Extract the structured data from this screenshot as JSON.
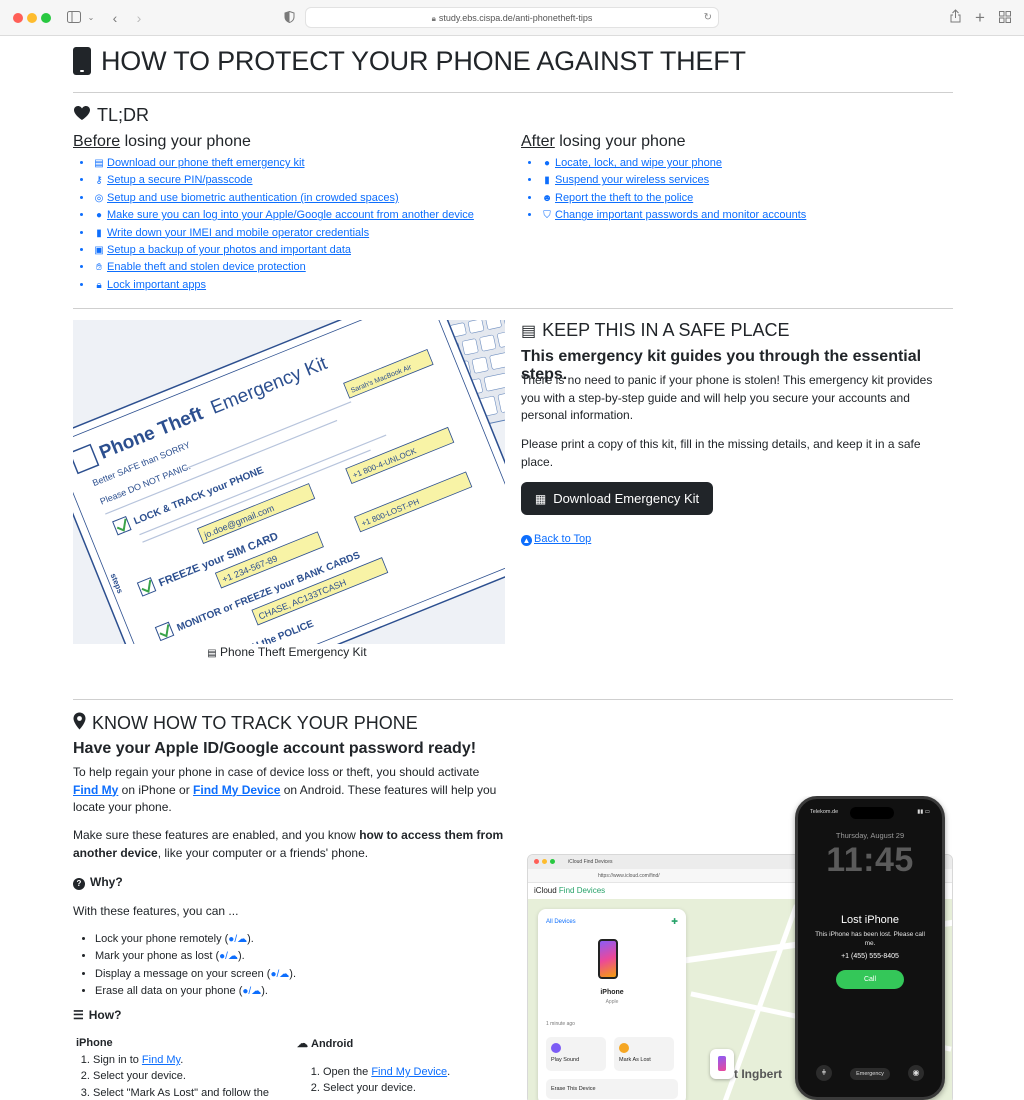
{
  "browser": {
    "url": "study.ebs.cispa.de/anti-phonetheft-tips"
  },
  "header": {
    "title": "HOW TO PROTECT YOUR PHONE AGAINST THEFT"
  },
  "tldr": {
    "heading": "TL;DR",
    "before": {
      "heading_u": "Before",
      "heading_rest": " losing your phone",
      "items": [
        {
          "icon": "pdf-icon",
          "label": "Download our phone theft emergency kit"
        },
        {
          "icon": "key-icon",
          "label": "Setup a secure PIN/passcode"
        },
        {
          "icon": "fingerprint-icon",
          "label": "Setup and use biometric authentication (in crowded spaces)"
        },
        {
          "icon": "location-pin-icon",
          "label": "Make sure you can log into your Apple/Google account from another device"
        },
        {
          "icon": "phone-icon",
          "label": "Write down your IMEI and mobile operator credentials"
        },
        {
          "icon": "images-icon",
          "label": "Setup a backup of your photos and important data"
        },
        {
          "icon": "hand-icon",
          "label": "Enable theft and stolen device protection"
        },
        {
          "icon": "lock-icon",
          "label": "Lock important apps"
        }
      ]
    },
    "after": {
      "heading_u": "After",
      "heading_rest": " losing your phone",
      "items": [
        {
          "icon": "location-pin-icon",
          "label": "Locate, lock, and wipe your phone"
        },
        {
          "icon": "phone-icon",
          "label": "Suspend your wireless services"
        },
        {
          "icon": "police-icon",
          "label": "Report the theft to the police"
        },
        {
          "icon": "shield-icon",
          "label": "Change important passwords and monitor accounts"
        }
      ]
    }
  },
  "kit": {
    "heading": "KEEP THIS IN A SAFE PLACE",
    "subheading": "This emergency kit guides you through the essential steps.",
    "para1": "There is no need to panic if your phone is stolen! This emergency kit provides you with a step-by-step guide and will help you secure your accounts and personal information.",
    "para2": "Please print a copy of this kit, fill in the missing details, and keep it in a safe place.",
    "button": "Download Emergency Kit",
    "back_to_top": "Back to Top",
    "caption": "Phone Theft Emergency Kit",
    "image": {
      "title_a": "Phone Theft",
      "title_b": "Emergency Kit",
      "tagline": "Better SAFE than SORRY",
      "dont_panic": "Please DO NOT PANIC.",
      "lock_track": "LOCK & TRACK your PHONE",
      "freeze_sim": "FREEZE your SIM CARD",
      "monitor": "MONITOR or FREEZE your BANK CARDS",
      "report": "REPORT WITH the POLICE",
      "field_email": "jo.doe@gmail.com",
      "field_phone": "+1 234-567-89",
      "field_bank": "CHASE, AC133TCASH",
      "field_num1": "+1 800-4-UNLOCK",
      "field_num2": "+1 800-LOST-PH",
      "field_device": "Sarah's MacBook Air",
      "steps_label": "steps"
    }
  },
  "track": {
    "heading": "KNOW HOW TO TRACK YOUR PHONE",
    "subheading": "Have your Apple ID/Google account password ready!",
    "p1_a": "To help regain your phone in case of device loss or theft, you should activate ",
    "p1_link1": "Find My",
    "p1_b": " on iPhone or ",
    "p1_link2": "Find My Device",
    "p1_c": " on Android. These features will help you locate your phone.",
    "p2_a": "Make sure these features are enabled, and you know ",
    "p2_bold": "how to access them from another device",
    "p2_b": ", like your computer or a friends' phone.",
    "why": "Why?",
    "with_features": "With these features, you can ...",
    "features": [
      "Lock your phone remotely (",
      "Mark your phone as lost (",
      "Display a message on your screen (",
      "Erase all data on your phone ("
    ],
    "how": "How?",
    "iphone": {
      "label": "iPhone",
      "step1_a": "Sign in to ",
      "step1_link": "Find My",
      "step1_b": ".",
      "step2": "Select your device.",
      "step3": "Select \"Mark As Lost\" and follow the"
    },
    "android": {
      "label": "Android",
      "step1_a": "Open the ",
      "step1_link": "Find My Device",
      "step1_b": ".",
      "step2": "Select your device."
    }
  },
  "findmy_image": {
    "tab": "iCloud Find Devices",
    "url": "https://www.icloud.com/find/",
    "app_a": "iCloud",
    "app_b": " Find Devices",
    "all_devices": "All Devices",
    "device_name": "iPhone",
    "device_sub": "Apple",
    "ago": "1 minute ago",
    "play_sound": "Play Sound",
    "mark_lost": "Mark As Lost",
    "erase": "Erase This Device",
    "town": "t Ingbert",
    "carrier": "Telekom.de",
    "date": "Thursday, August 29",
    "time": "11:45",
    "lost_title": "Lost iPhone",
    "lost_msg": "This iPhone has been lost. Please call me.",
    "lost_number": "+1 (455) 555-8405",
    "call": "Call",
    "emergency": "Emergency"
  }
}
